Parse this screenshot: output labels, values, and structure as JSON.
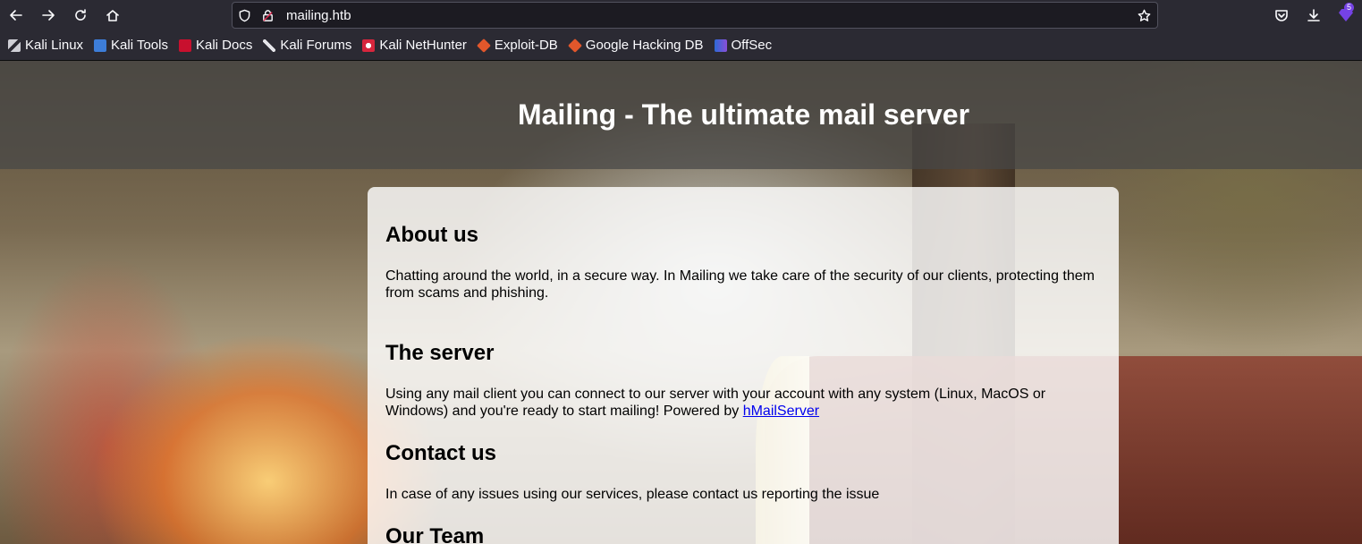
{
  "browser": {
    "url": "mailing.htb",
    "extension_badge_count": "5",
    "bookmarks": [
      {
        "label": "Kali Linux",
        "icon": "kali-linux-icon"
      },
      {
        "label": "Kali Tools",
        "icon": "kali-tools-icon"
      },
      {
        "label": "Kali Docs",
        "icon": "kali-docs-icon"
      },
      {
        "label": "Kali Forums",
        "icon": "kali-forums-icon"
      },
      {
        "label": "Kali NetHunter",
        "icon": "kali-nethunter-icon"
      },
      {
        "label": "Exploit-DB",
        "icon": "exploit-db-icon"
      },
      {
        "label": "Google Hacking DB",
        "icon": "google-hacking-db-icon"
      },
      {
        "label": "OffSec",
        "icon": "offsec-icon"
      }
    ]
  },
  "site": {
    "title": "Mailing - The ultimate mail server"
  },
  "content": {
    "about": {
      "heading": "About us",
      "text": "Chatting around the world, in a secure way. In Mailing we take care of the security of our clients, protecting them from scams and phishing."
    },
    "server": {
      "heading": "The server",
      "text": "Using any mail client you can connect to our server with your account with any system (Linux, MacOS or Windows) and you're ready to start mailing! Powered by ",
      "link_label": "hMailServer"
    },
    "contact": {
      "heading": "Contact us",
      "text": "In case of any issues using our services, please contact us reporting the issue"
    },
    "team": {
      "heading": "Our Team"
    }
  },
  "colors": {
    "chrome_bg": "#2b2a33",
    "urlbar_bg": "#1c1b22",
    "link": "#0000ee",
    "accent": "#7542e5"
  }
}
